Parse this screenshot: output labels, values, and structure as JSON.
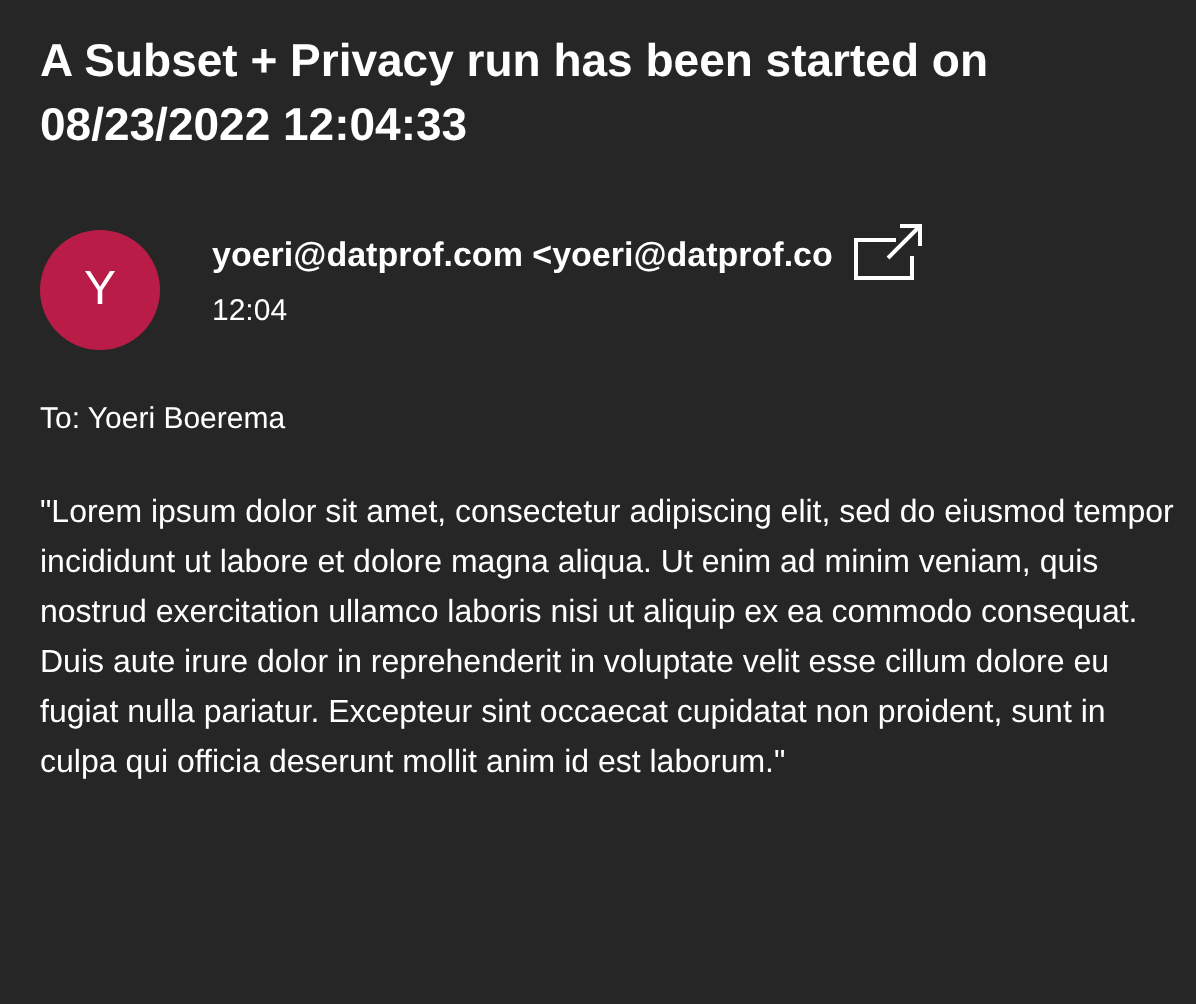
{
  "subject": "A Subset + Privacy run has been started on 08/23/2022 12:04:33",
  "sender": {
    "avatar_letter": "Y",
    "name": "yoeri@datprof.com <yoeri@datprof.co",
    "time": "12:04"
  },
  "to": "To: Yoeri Boerema",
  "body": "\"Lorem ipsum dolor sit amet, consectetur adipiscing elit, sed do eiusmod tempor incididunt ut labore et dolore magna aliqua. Ut enim ad minim veniam, quis nostrud exercitation ullamco laboris nisi ut aliquip ex ea commodo consequat. Duis aute irure dolor in reprehenderit in voluptate velit esse cillum dolore eu fugiat nulla pariatur. Excepteur sint occaecat cupidatat non proident, sunt in culpa qui officia deserunt mollit anim id est laborum.\""
}
